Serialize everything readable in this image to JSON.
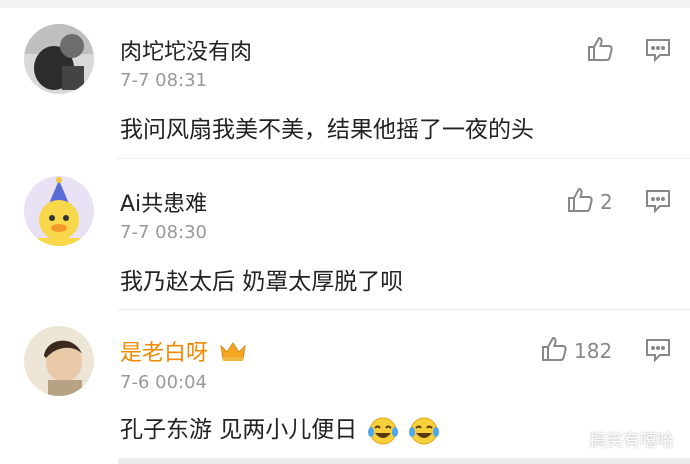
{
  "comments": [
    {
      "username": "肉坨坨没有肉",
      "time": "7-7 08:31",
      "text": "我问风扇我美不美，结果他摇了一夜的头",
      "likes": ""
    },
    {
      "username": "Ai共患难",
      "time": "7-7 08:30",
      "text": "我乃赵太后 奶罩太厚脱了呗",
      "likes": "2"
    },
    {
      "username": "是老白呀",
      "time": "7-6 00:04",
      "text": "孔子东游 见两小儿便日",
      "likes": "182"
    }
  ],
  "watermark": "搞笑有嘻哈",
  "colors": {
    "vip_name": "#f08a00",
    "time": "#999999",
    "icon": "#888888"
  }
}
